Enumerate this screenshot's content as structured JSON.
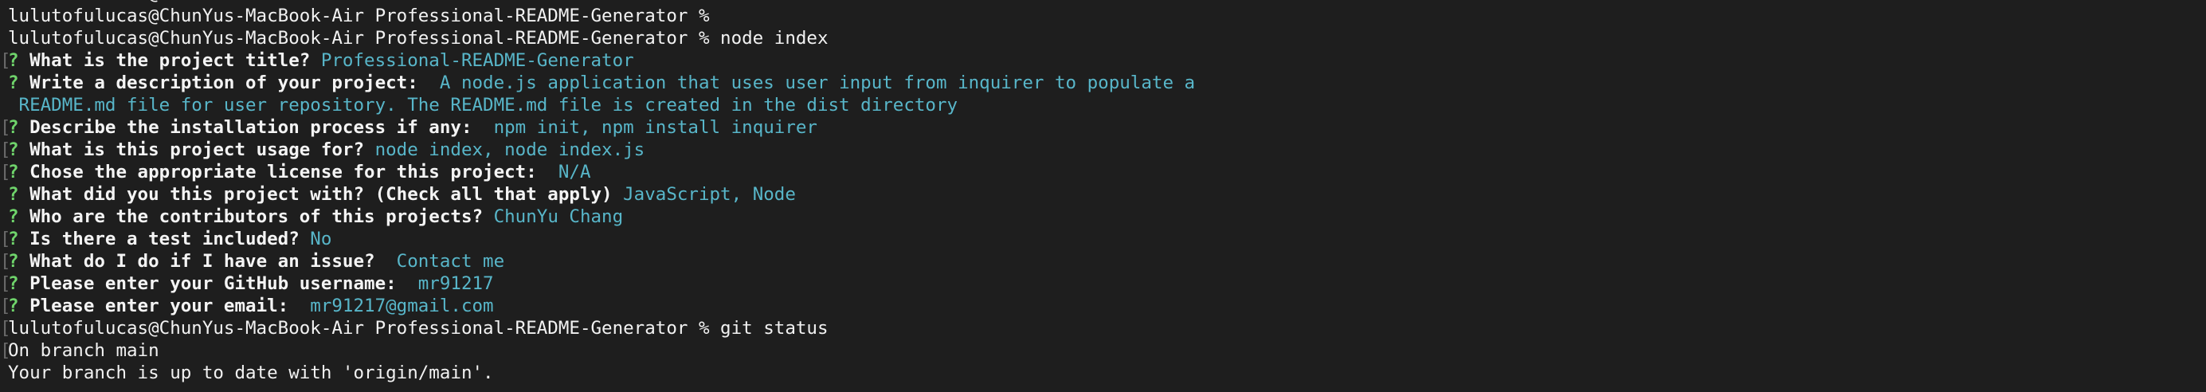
{
  "terminal": {
    "lines": [
      {
        "kind": "cut",
        "text": "lulutofulucas@ChunYus-MacBook-Air Professional-README-Generator % "
      },
      {
        "kind": "prompt",
        "text": "lulutofulucas@ChunYus-MacBook-Air Professional-README-Generator %"
      },
      {
        "kind": "prompt",
        "text": "lulutofulucas@ChunYus-MacBook-Air Professional-README-Generator % node index"
      },
      {
        "kind": "qa",
        "mark": "[",
        "q": "?",
        "question": "What is the project title?",
        "answer": "Professional-README-Generator"
      },
      {
        "kind": "qa",
        "mark": "",
        "q": "?",
        "question": "Write a description of your project:",
        "answer": " A node.js application that uses user input from inquirer to populate a"
      },
      {
        "kind": "cont",
        "answer": " README.md file for user repository. The README.md file is created in the dist directory"
      },
      {
        "kind": "qa",
        "mark": "[",
        "q": "?",
        "question": "Describe the installation process if any:",
        "answer": " npm init, npm install inquirer"
      },
      {
        "kind": "qa",
        "mark": "[",
        "q": "?",
        "question": "What is this project usage for?",
        "answer": "node index, node index.js"
      },
      {
        "kind": "qa",
        "mark": "[",
        "q": "?",
        "question": "Chose the appropriate license for this project:",
        "answer": " N/A"
      },
      {
        "kind": "qa",
        "mark": "",
        "q": "?",
        "question": "What did you this project with? (Check all that apply)",
        "answer": "JavaScript, Node"
      },
      {
        "kind": "qa",
        "mark": "",
        "q": "?",
        "question": "Who are the contributors of this projects?",
        "answer": "ChunYu Chang"
      },
      {
        "kind": "qa",
        "mark": "[",
        "q": "?",
        "question": "Is there a test included?",
        "answer": "No"
      },
      {
        "kind": "qa",
        "mark": "[",
        "q": "?",
        "question": "What do I do if I have an issue?",
        "answer": " Contact me"
      },
      {
        "kind": "qa",
        "mark": "[",
        "q": "?",
        "question": "Please enter your GitHub username:",
        "answer": " mr91217"
      },
      {
        "kind": "qa",
        "mark": "[",
        "q": "?",
        "question": "Please enter your email:",
        "answer": " mr91217@gmail.com"
      },
      {
        "kind": "prompt",
        "mark": "[",
        "text": "lulutofulucas@ChunYus-MacBook-Air Professional-README-Generator % git status"
      },
      {
        "kind": "output",
        "mark": "[",
        "text": "On branch main"
      },
      {
        "kind": "output",
        "text": "Your branch is up to date with 'origin/main'."
      }
    ]
  },
  "colors": {
    "background": "#1e1e1e",
    "text": "#f2f2f2",
    "question_mark": "#6fd46b",
    "answer": "#58b6c9"
  }
}
